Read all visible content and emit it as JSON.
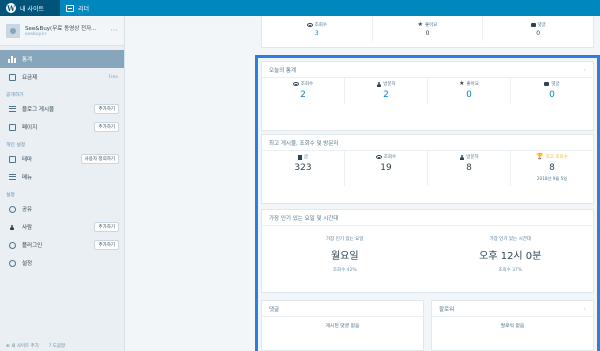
{
  "topbar": {
    "my_site": "내 사이트",
    "reader": "리더"
  },
  "site": {
    "title": "See&Buy(무료 동영상 전자...",
    "url": "seebuy.kr"
  },
  "sidebar": {
    "stats": "통계",
    "plans": "요금제",
    "plans_tag": "Free",
    "section_manage": "공개하기",
    "blog_posts": "블로그 게시물",
    "blog_posts_btn": "추가하기",
    "pages": "페이지",
    "pages_btn": "추가하기",
    "section_personalize": "개인 설정",
    "themes": "테마",
    "themes_btn": "사용자 정의하기",
    "menus": "메뉴",
    "section_settings": "설정",
    "sharing": "공유",
    "people": "사람",
    "people_btn": "추가하기",
    "plugins": "플러그인",
    "plugins_btn": "추가하기",
    "settings": "설정",
    "footer_add_site": "새 사이트 추가",
    "footer_help": "도움말"
  },
  "top_strip": {
    "views_label": "조회수",
    "views_value": "3",
    "likes_label": "좋아요",
    "likes_value": "0",
    "comments_label": "댓글",
    "comments_value": "0"
  },
  "today": {
    "title": "오늘의 통계",
    "views_label": "조회수",
    "views_value": "2",
    "visitors_label": "방문자",
    "visitors_value": "2",
    "likes_label": "좋아요",
    "likes_value": "0",
    "comments_label": "댓글",
    "comments_value": "0"
  },
  "best": {
    "title": "최고 게시물, 조회수 및 방문자",
    "posts_label": "글",
    "posts_value": "323",
    "views_label": "조회수",
    "views_value": "19",
    "visitors_label": "방문자",
    "visitors_value": "8",
    "best_label": "최고 조회수",
    "best_value": "8",
    "best_date": "2018년 9월 5일"
  },
  "popular": {
    "title": "가장 인기 있는 요일 및 시간대",
    "day_label": "가장 인기 있는 요일",
    "day_value": "월요일",
    "day_pct": "조회수 42%",
    "hour_label": "가장 인기 있는 시간대",
    "hour_value": "오후 12시 0분",
    "hour_pct": "조회수 37%"
  },
  "comments_card": {
    "title": "댓글",
    "empty": "게시된 댓글 없음"
  },
  "followers_card": {
    "title": "팔로워",
    "empty": "팔로워 없음"
  },
  "colors": {
    "wp_blue": "#0087be",
    "highlight": "#2b7de9",
    "selected": "#87a6bc"
  }
}
